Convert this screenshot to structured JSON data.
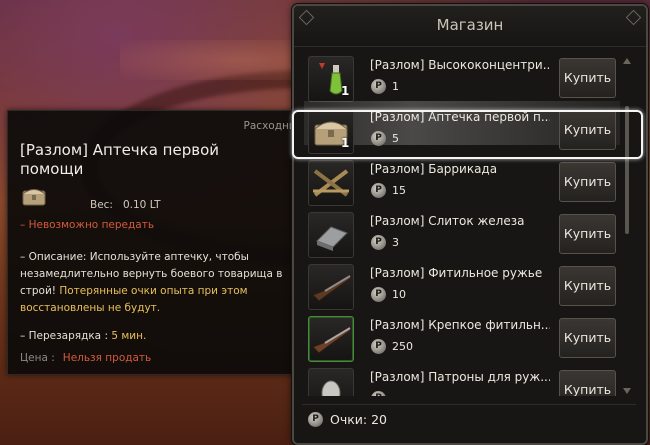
{
  "shop": {
    "title": "Магазин",
    "items": [
      {
        "name": "[Разлом] Высококонцентри...",
        "qty": "1",
        "price": "1",
        "buy_label": "Купить",
        "icon": "green-potion-icon"
      },
      {
        "name": "[Разлом] Аптечка первой п...",
        "qty": "1",
        "price": "5",
        "buy_label": "Купить",
        "icon": "medkit-chest-icon",
        "selected": true
      },
      {
        "name": "[Разлом] Баррикада",
        "qty": "",
        "price": "15",
        "buy_label": "Купить",
        "icon": "barricade-icon"
      },
      {
        "name": "[Разлом] Слиток железа",
        "qty": "",
        "price": "3",
        "buy_label": "Купить",
        "icon": "iron-ingot-icon"
      },
      {
        "name": "[Разлом] Фитильное ружье",
        "qty": "",
        "price": "10",
        "buy_label": "Купить",
        "icon": "musket-icon"
      },
      {
        "name": "[Разлом] Крепкое фитильн...",
        "qty": "",
        "price": "250",
        "buy_label": "Купить",
        "icon": "sturdy-musket-icon"
      },
      {
        "name": "[Разлом] Патроны для руж...",
        "qty": "",
        "price": "",
        "buy_label": "Купить",
        "icon": "bullet-icon"
      }
    ],
    "currency_symbol": "P",
    "points_label": "Очки: 20"
  },
  "tooltip": {
    "category": "Расходник",
    "title": "[Разлом] Аптечка первой помощи",
    "weight_label": "Вес:",
    "weight_value": "0.10 LT",
    "untradeable": "– Невозможно передать",
    "desc_prefix": "– Описание: Используйте аптечку, чтобы незамедлительно вернуть боевого товарища в строй!",
    "desc_highlight": "Потерянные очки опыта при этом восстановлены не будут.",
    "cooldown_label": "– Перезарядка :",
    "cooldown_value": "5 мин.",
    "price_label": "Цена :",
    "price_value": "Нельзя продать"
  },
  "colors": {
    "accent_yellow": "#e7c05a",
    "warning_red": "#d35a3c",
    "selection_outline": "#f5f5f5"
  }
}
